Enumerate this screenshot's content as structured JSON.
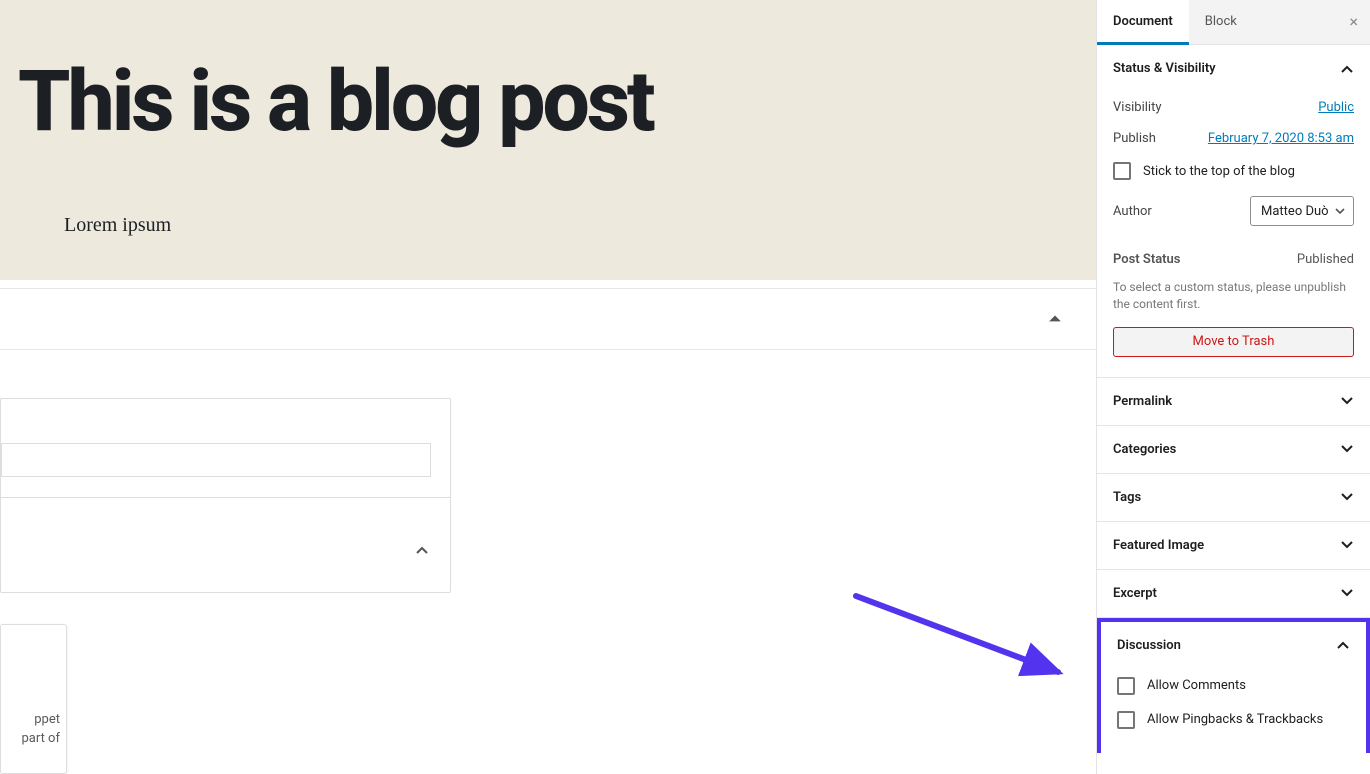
{
  "editor": {
    "title": "This is a blog post",
    "body": "Lorem ipsum"
  },
  "snippet": {
    "line1": "ppet",
    "line2": "part of"
  },
  "sidebar": {
    "tabs": {
      "document": "Document",
      "block": "Block"
    },
    "close": "×",
    "status_visibility": {
      "title": "Status & Visibility",
      "visibility_label": "Visibility",
      "visibility_value": "Public",
      "publish_label": "Publish",
      "publish_value": "February 7, 2020 8:53 am",
      "stick_label": "Stick to the top of the blog",
      "author_label": "Author",
      "author_value": "Matteo Duò",
      "post_status_label": "Post Status",
      "post_status_value": "Published",
      "hint": "To select a custom status, please unpublish the content first.",
      "trash": "Move to Trash"
    },
    "panels": {
      "permalink": "Permalink",
      "categories": "Categories",
      "tags": "Tags",
      "featured_image": "Featured Image",
      "excerpt": "Excerpt"
    },
    "discussion": {
      "title": "Discussion",
      "allow_comments": "Allow Comments",
      "allow_pingbacks": "Allow Pingbacks & Trackbacks"
    }
  }
}
